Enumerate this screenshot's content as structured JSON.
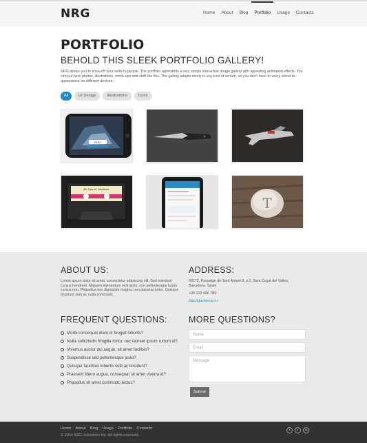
{
  "header": {
    "logo": "NRG",
    "nav": [
      "Home",
      "About",
      "Blog",
      "Portfolio",
      "Usage",
      "Contacts"
    ],
    "active_nav": "Portfolio"
  },
  "main": {
    "title": "PORTFOLIO",
    "subtitle": "BEHOLD THIS SLEEK PORTFOLIO GALLERY!",
    "intro": "NRG allows you to show off your skills to people. The portfolio represents a very simple interactive image gallery with appealing animation effects. You can put here photos, illustrations, mock-ups and stuff like this. The gallery adapts nicely to any kind of screen, so you don't have to worry about its appearance on different devices.",
    "filters": [
      "All",
      "UI Design",
      "Illustrations",
      "Icons"
    ],
    "active_filter": "All",
    "gallery": [
      {
        "icon": "phone-game-image",
        "label": "PLAY"
      },
      {
        "icon": "knife-image"
      },
      {
        "icon": "blaster-image"
      },
      {
        "icon": "cassette-image",
        "label": "Mix Tape for Jellybeans"
      },
      {
        "icon": "mobile-app-image"
      },
      {
        "icon": "stone-image",
        "label": "T"
      }
    ]
  },
  "about": {
    "title": "ABOUT US:",
    "text": "Lorem ipsum dolor sit amet, consectetur adipiscing elit. Sed interdum cursus hendrerit. Aliquam elementum velit dolor, non pellentesque turpis cursus non. Phasellus nec dignissim magna, non placerat tortor. Quisque tincidunt sem ac nulla commodo."
  },
  "address": {
    "title": "ADDRESS:",
    "line1": "08172, Passatge de Sant Antoni 8, p.2, Sant Cugat del Valles,",
    "line2": "Barcelona, Spain",
    "phone": "+34 123 456 789",
    "url": "http://gianttesip.ru"
  },
  "faq": {
    "title": "FREQUENT QUESTIONS:",
    "items": [
      "Morbi consequat diam et feugiat lobortis?",
      "Nulla sollicitudin fringilla tortor, nec laoreet ipsum rutrum id?",
      "Vivamus auctor dui augue, sit amet facilisis?",
      "Suspendisse sed pellentesque justo?",
      "Quisque faucibus lobortis velit ac tincidunt?",
      "Praesent libero augue, consequat sit amet viverra id?",
      "Phasellus sit amet commodo lectus?"
    ]
  },
  "contact": {
    "title": "MORE QUESTIONS?",
    "name_placeholder": "Name",
    "email_placeholder": "Email",
    "message_placeholder": "Message",
    "submit": "Submit"
  },
  "footer": {
    "nav": [
      "Home",
      "About",
      "Blog",
      "Usage",
      "Portfolio",
      "Contacts"
    ],
    "copyright": "© 2014 NRG Industries Inc. All rights reserved.",
    "social": [
      "f",
      "t",
      "in"
    ]
  },
  "colors": {
    "accent": "#1f8bc4",
    "footer": "#333333",
    "gray_band": "#eaeaea"
  }
}
